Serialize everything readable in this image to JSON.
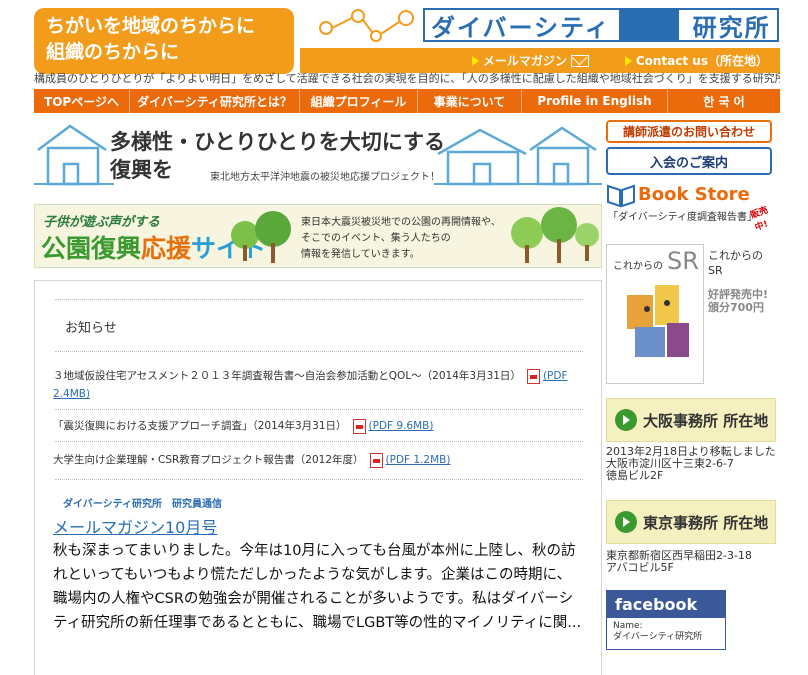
{
  "header": {
    "slogan_line1": "ちがいを地域のちからに",
    "slogan_line2": "組織のちからに",
    "logo_text": "ダイバーシティ",
    "logo_text2": "研究所",
    "mail_magazine": "メールマガジン",
    "contact": "Contact us（所在地）",
    "tagline": "構成員のひとりひとりが「よりよい明日」をめざして活躍できる社会の実現を目的に、「人の多様性に配慮した組織や地域社会づくり」を支援する研究所です"
  },
  "nav": [
    "TOPページへ",
    "ダイバーシティ研究所とは？",
    "組織プロフィール",
    "事業について",
    "Profile in English",
    "한 국 어"
  ],
  "banner1": {
    "line1": "多様性・ひとりひとりを大切にする",
    "line2": "復興を",
    "sub": "東北地方太平洋沖地震の被災地応援プロジェクト！"
  },
  "banner2": {
    "kicker": "子供が遊ぶ声がする",
    "title_green": "公園復興",
    "title_orange": "応援",
    "title_blue": "サイト",
    "desc1": "東日本大震災被災地での公園の再開情報や、",
    "desc2": "そこでのイベント、集う人たちの",
    "desc3": "情報を発信していきます。"
  },
  "main": {
    "oshirase": "お知らせ",
    "news": [
      {
        "text": "３地域仮設住宅アセスメント２０１３年調査報告書〜自治会参加活動とQOL〜（2014年3月31日）",
        "pdf": "(PDF",
        "pdf2": "2.4MB)"
      },
      {
        "text": "「震災復興における支援アプローチ調査」（2014年3月31日）",
        "pdf": "(PDF 9.6MB)"
      },
      {
        "text": "大学生向け企業理解・CSR教育プロジェクト報告書（2012年度）",
        "pdf": "(PDF 1.2MB)"
      }
    ],
    "category": "ダイバーシティ研究所　研究員通信",
    "mm_title": "メールマガジン10月号",
    "body": "秋も深まってまいりました。今年は10月に入っても台風が本州に上陸し、秋の訪れといってもいつもより慌ただしかったような気がします。企業はこの時期に、職場内の人権やCSRの勉強会が開催されることが多いようです。私はダイバーシティ研究所の新任理事であるとともに、職場でLGBT等の性的マイノリティに関..."
  },
  "sidebar": {
    "btn_lecturer": "講師派遣のお問い合わせ",
    "btn_join": "入会のご案内",
    "bookstore": "Book Store",
    "bookstore_sub": "「ダイバーシティ度調査報告書」",
    "bookstore_hot": "販売中!",
    "book_cover_title": "これからの",
    "book_cover_sr": "SR",
    "book_title1": "これからの",
    "book_title2": "SR",
    "book_note1": "好評発売中!",
    "book_note2": "頒分700円",
    "osaka_title": "大阪事務所 所在地",
    "osaka_addr1": "2013年2月18日より移転しました",
    "osaka_addr2": "大阪市淀川区十三東2-6-7",
    "osaka_addr3": "徳島ビル2F",
    "tokyo_title": "東京事務所 所在地",
    "tokyo_addr1": "東京都新宿区西早稲田2-3-18",
    "tokyo_addr2": "アバコビル5F",
    "facebook": "facebook",
    "fb_name_label": "Name:",
    "fb_name": "ダイバーシティ研究所"
  },
  "colors": {
    "orange": "#f39c1b",
    "nav": "#ea6a0c",
    "blue": "#2a6db3",
    "green": "#3b9a2f"
  }
}
